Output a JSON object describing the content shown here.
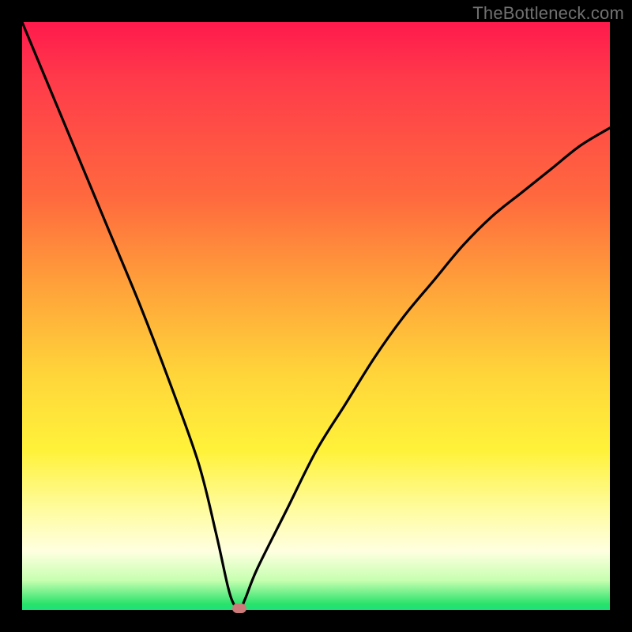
{
  "watermark": "TheBottleneck.com",
  "chart_data": {
    "type": "line",
    "title": "",
    "xlabel": "",
    "ylabel": "",
    "xlim": [
      0,
      100
    ],
    "ylim": [
      0,
      100
    ],
    "grid": false,
    "legend": false,
    "series": [
      {
        "name": "bottleneck-curve",
        "x": [
          0,
          5,
          10,
          15,
          20,
          25,
          30,
          33,
          35,
          36,
          37,
          38,
          40,
          45,
          50,
          55,
          60,
          65,
          70,
          75,
          80,
          85,
          90,
          95,
          100
        ],
        "values": [
          100,
          88,
          76,
          64,
          52,
          39,
          25,
          13,
          4,
          1,
          0,
          2,
          7,
          17,
          27,
          35,
          43,
          50,
          56,
          62,
          67,
          71,
          75,
          79,
          82
        ]
      }
    ],
    "annotations": [
      {
        "type": "marker",
        "name": "min-point",
        "x": 37,
        "y": 0
      }
    ],
    "background_gradient": {
      "direction": "vertical",
      "stops": [
        {
          "pos": 0.0,
          "color": "#ff1a4d"
        },
        {
          "pos": 0.3,
          "color": "#ff6a3e"
        },
        {
          "pos": 0.6,
          "color": "#ffd53a"
        },
        {
          "pos": 0.83,
          "color": "#fffca0"
        },
        {
          "pos": 0.95,
          "color": "#c6ffb0"
        },
        {
          "pos": 1.0,
          "color": "#1de27d"
        }
      ]
    }
  },
  "colors": {
    "frame": "#000000",
    "curve": "#000000",
    "marker": "#cc7a7a"
  }
}
